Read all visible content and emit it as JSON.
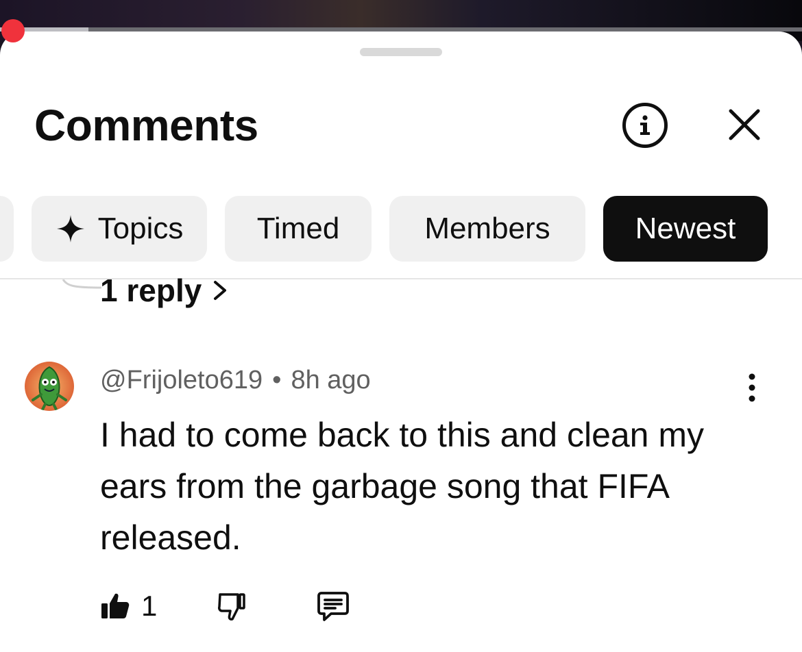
{
  "player": {
    "progress_fraction": 0.11,
    "accent_color": "#f0323c"
  },
  "sheet": {
    "title": "Comments",
    "info_icon": "info-icon",
    "close_icon": "close-icon"
  },
  "chips": {
    "topics_label": "Topics",
    "timed_label": "Timed",
    "members_label": "Members",
    "newest_label": "Newest",
    "active": "Newest"
  },
  "previous_thread": {
    "replies_label": "1 reply"
  },
  "comment": {
    "author": "@Frijoleto619",
    "separator": "•",
    "time": "8h ago",
    "text": "I had to come back to this and clean my ears from the garbage song that FIFA released.",
    "like_count": "1"
  }
}
